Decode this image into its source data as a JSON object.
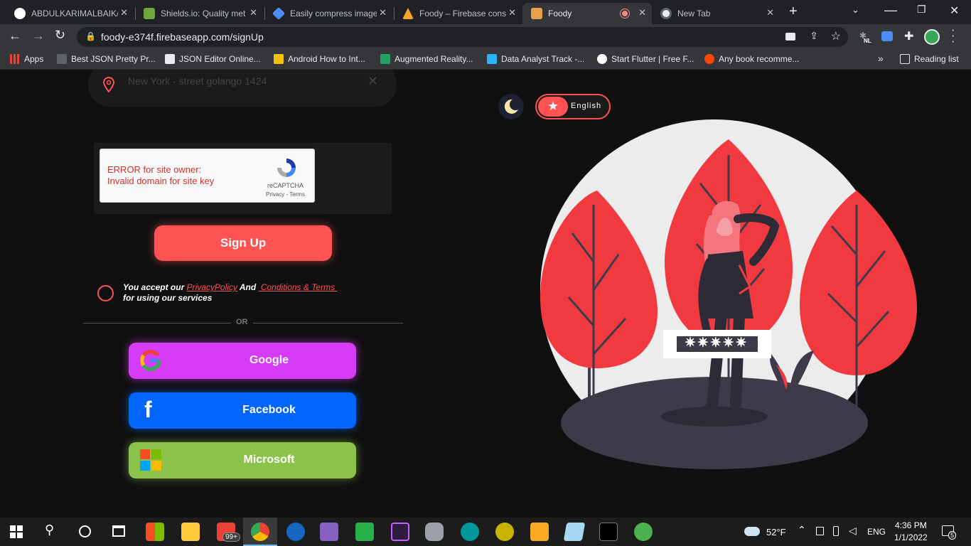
{
  "browser": {
    "tabs": [
      {
        "title": "ABDULKARIMALBAIK/",
        "favicon_color": "#ffffff"
      },
      {
        "title": "Shields.io: Quality met",
        "favicon_color": "#6fa83a"
      },
      {
        "title": "Easily compress image",
        "favicon_color": "#4e8df5"
      },
      {
        "title": "Foody – Firebase cons",
        "favicon_color": "#f6a623"
      },
      {
        "title": "Foody",
        "favicon_color": "#e8a04a"
      },
      {
        "title": "New Tab",
        "favicon_color": "#9aa0a6"
      }
    ],
    "url": "foody-e374f.firebaseapp.com/signUp",
    "bookmarks": [
      {
        "label": "Apps",
        "color": "#e94335"
      },
      {
        "label": "Best JSON Pretty Pr...",
        "color": "#5f6368"
      },
      {
        "label": "JSON Editor Online...",
        "color": "#e8eaed"
      },
      {
        "label": "Android How to Int...",
        "color": "#f4c20d"
      },
      {
        "label": "Augmented Reality...",
        "color": "#21a366"
      },
      {
        "label": "Data Analyst Track -...",
        "color": "#2ab6f6"
      },
      {
        "label": "Start Flutter | Free F...",
        "color": "#ffffff"
      },
      {
        "label": "Any book recomme...",
        "color": "#ff4500"
      }
    ],
    "reading_list": "Reading list",
    "chevron": "»",
    "extension_badge": "NL"
  },
  "form": {
    "address_placeholder": "New York - street golango 1424",
    "recaptcha": {
      "error_line1": "ERROR for site owner:",
      "error_line2": "Invalid domain for site key",
      "brand": "reCAPTCHA",
      "links": "Privacy - Terms"
    },
    "signup_label": "Sign Up",
    "terms": {
      "prefix": "You accept our ",
      "privacy": "PrivacyPolicy",
      "and": " And ",
      "conditions": " Conditions & Terms ",
      "suffix": "for using our services"
    },
    "or_label": "OR",
    "social": [
      {
        "label": "Google",
        "color": "#d63cf5"
      },
      {
        "label": "Facebook",
        "color": "#0066ff"
      },
      {
        "label": "Microsoft",
        "color": "#8bc34a"
      }
    ]
  },
  "controls": {
    "language_label": "English",
    "accent": "#ff5252"
  },
  "illustration": {
    "password_mask": "✷✷✷✷✷"
  },
  "taskbar": {
    "weather": "52°F",
    "lang": "ENG",
    "time": "4:36 PM",
    "date": "1/1/2022",
    "badge": "99+",
    "notifications": "5"
  }
}
